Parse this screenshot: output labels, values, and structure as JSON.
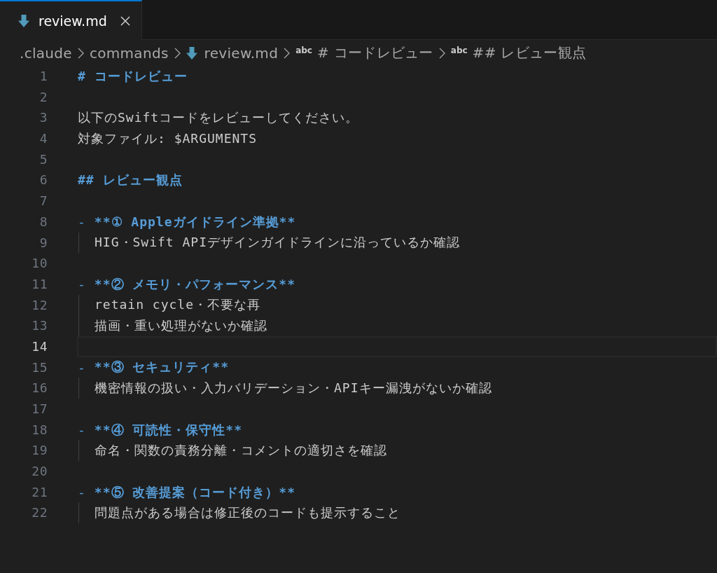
{
  "tab": {
    "label": "review.md",
    "selected": true
  },
  "breadcrumbs": [
    {
      "label": ".claude",
      "kind": "folder"
    },
    {
      "label": "commands",
      "kind": "folder"
    },
    {
      "label": "review.md",
      "kind": "file"
    },
    {
      "label": "# コードレビュー",
      "kind": "symbol",
      "symbol": "abc"
    },
    {
      "label": "## レビュー観点",
      "kind": "symbol",
      "symbol": "abc"
    }
  ],
  "lines": [
    {
      "number": "1",
      "kind": "heading",
      "text": "# コードレビュー",
      "current": false
    },
    {
      "number": "2",
      "kind": "blank",
      "current": false
    },
    {
      "number": "3",
      "kind": "text",
      "text": "以下のSwiftコードをレビューしてください。",
      "current": false
    },
    {
      "number": "4",
      "kind": "text",
      "text": "対象ファイル: $ARGUMENTS",
      "current": false
    },
    {
      "number": "5",
      "kind": "blank",
      "current": false
    },
    {
      "number": "6",
      "kind": "heading",
      "text": "## レビュー観点",
      "current": false
    },
    {
      "number": "7",
      "kind": "blank",
      "current": false
    },
    {
      "number": "8",
      "kind": "list_item",
      "marker": "-",
      "text": "**① Appleガイドライン準拠**",
      "current": false
    },
    {
      "number": "9",
      "kind": "continuation",
      "text": "HIG・Swift APIデザインガイドラインに沿っているか確認",
      "current": false
    },
    {
      "number": "10",
      "kind": "blank",
      "current": false
    },
    {
      "number": "11",
      "kind": "list_item",
      "marker": "-",
      "text": "**② メモリ・パフォーマンス**",
      "current": false
    },
    {
      "number": "12",
      "kind": "continuation",
      "text": "retain cycle・不要な再",
      "current": false
    },
    {
      "number": "13",
      "kind": "continuation",
      "text": "描画・重い処理がないか確認",
      "current": false
    },
    {
      "number": "14",
      "kind": "blank",
      "current": true
    },
    {
      "number": "15",
      "kind": "list_item",
      "marker": "-",
      "text": "**③ セキュリティ**",
      "current": false
    },
    {
      "number": "16",
      "kind": "continuation",
      "text": "機密情報の扱い・入力バリデーション・APIキー漏洩がないか確認",
      "current": false
    },
    {
      "number": "17",
      "kind": "blank",
      "current": false
    },
    {
      "number": "18",
      "kind": "list_item",
      "marker": "-",
      "text": "**④ 可読性・保守性**",
      "current": false
    },
    {
      "number": "19",
      "kind": "continuation",
      "text": "命名・関数の責務分離・コメントの適切さを確認",
      "current": false
    },
    {
      "number": "20",
      "kind": "blank",
      "current": false
    },
    {
      "number": "21",
      "kind": "list_item",
      "marker": "-",
      "text": "**⑤ 改善提案（コード付き）**",
      "current": false
    },
    {
      "number": "22",
      "kind": "continuation",
      "text": "問題点がある場合は修正後のコードも提示すること",
      "current": false
    }
  ]
}
